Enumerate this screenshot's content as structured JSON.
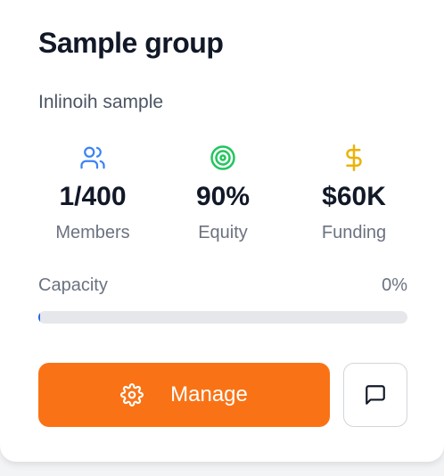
{
  "card": {
    "title": "Sample group",
    "subtitle": "Inlinoih sample"
  },
  "stats": [
    {
      "icon": "users-icon",
      "value": "1/400",
      "label": "Members",
      "color": "#3b82f6"
    },
    {
      "icon": "target-icon",
      "value": "90%",
      "label": "Equity",
      "color": "#22c55e"
    },
    {
      "icon": "dollar-icon",
      "value": "$60K",
      "label": "Funding",
      "color": "#eab308"
    }
  ],
  "capacity": {
    "label": "Capacity",
    "value_text": "0%",
    "fraction": 0
  },
  "actions": {
    "manage_label": "Manage",
    "manage_icon": "gear-icon",
    "chat_icon": "message-square-icon"
  },
  "colors": {
    "primary": "#f97316",
    "progress": "#2563eb",
    "track": "#e5e7eb"
  }
}
